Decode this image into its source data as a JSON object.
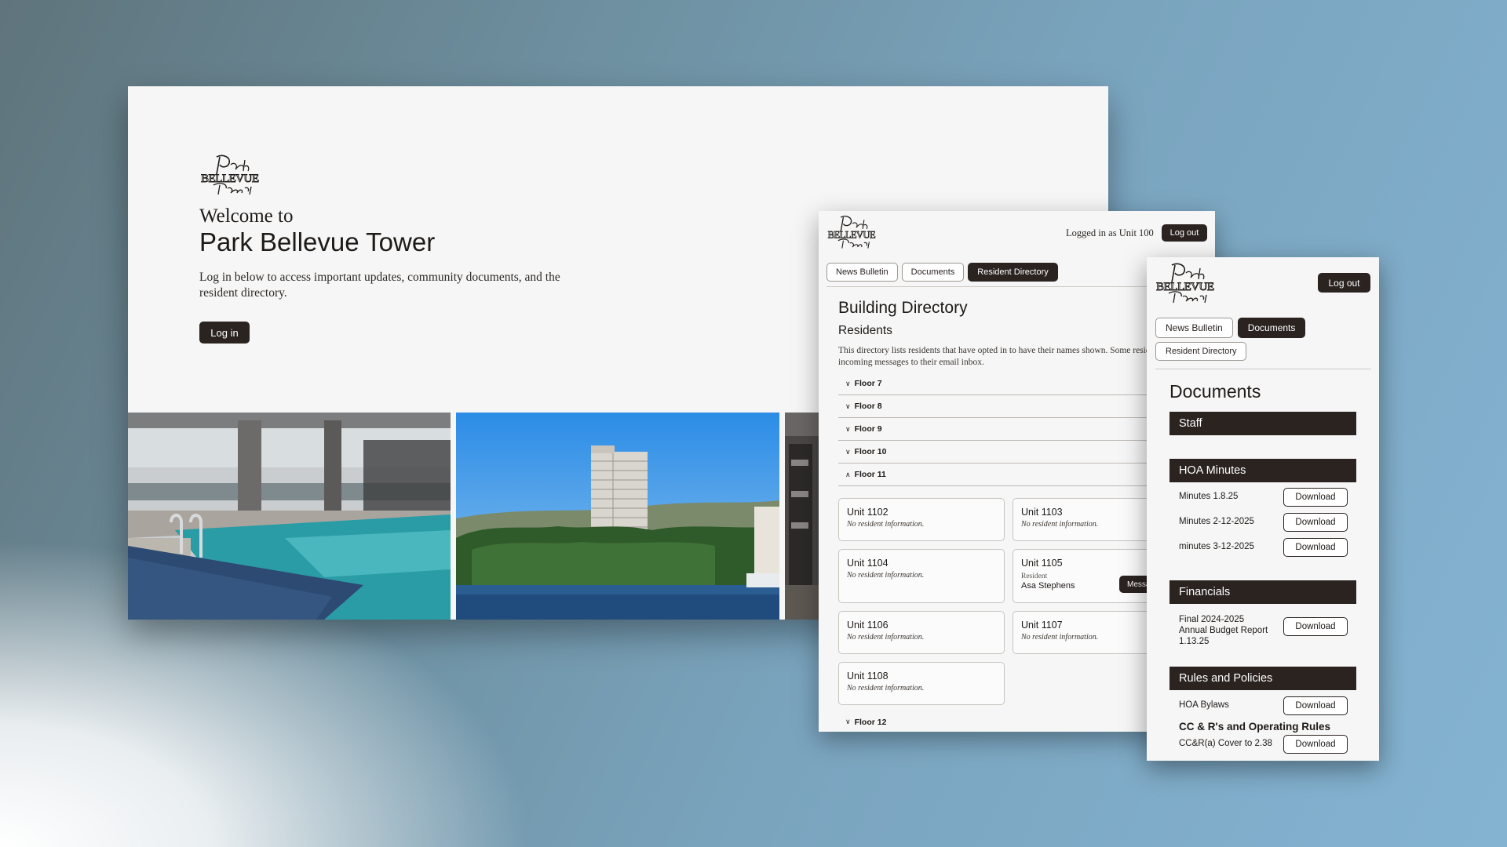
{
  "landing": {
    "welcome_pre": "Welcome to",
    "title": "Park Bellevue Tower",
    "description": "Log in below to access important updates, community documents, and the resident directory.",
    "login_label": "Log in"
  },
  "directory_window": {
    "logged_in_text": "Logged in as Unit 100",
    "logout_label": "Log out",
    "tabs": [
      {
        "label": "News Bulletin"
      },
      {
        "label": "Documents"
      },
      {
        "label": "Resident Directory"
      }
    ],
    "active_tab": "Resident Directory",
    "heading": "Building Directory",
    "subheading": "Residents",
    "description": "This directory lists residents that have opted in to have their names shown. Some residents have allowed incoming messages to their email inbox.",
    "floors_before": [
      {
        "label": "Floor 7",
        "expanded": false
      },
      {
        "label": "Floor 8",
        "expanded": false
      },
      {
        "label": "Floor 9",
        "expanded": false
      },
      {
        "label": "Floor 10",
        "expanded": false
      },
      {
        "label": "Floor 11",
        "expanded": true
      }
    ],
    "units": [
      {
        "name": "Unit 1102",
        "info": "No resident information."
      },
      {
        "name": "Unit 1103",
        "info": "No resident information."
      },
      {
        "name": "Unit 1104",
        "info": "No resident information."
      },
      {
        "name": "Unit 1105",
        "resident_label": "Resident",
        "resident_name": "Asa Stephens",
        "message_label": "Message"
      },
      {
        "name": "Unit 1106",
        "info": "No resident information."
      },
      {
        "name": "Unit 1107",
        "info": "No resident information."
      },
      {
        "name": "Unit 1108",
        "info": "No resident information."
      }
    ],
    "floors_after": [
      {
        "label": "Floor 12",
        "expanded": false
      }
    ]
  },
  "documents_window": {
    "logout_label": "Log out",
    "tabs": [
      {
        "label": "News Bulletin"
      },
      {
        "label": "Documents"
      },
      {
        "label": "Resident Directory"
      }
    ],
    "active_tab": "Documents",
    "heading": "Documents",
    "download_label": "Download",
    "sections": {
      "staff": {
        "title": "Staff"
      },
      "hoa_minutes": {
        "title": "HOA Minutes",
        "docs": [
          "Minutes 1.8.25",
          "Minutes 2-12-2025",
          "minutes 3-12-2025"
        ]
      },
      "financials": {
        "title": "Financials",
        "docs": [
          "Final 2024-2025 Annual Budget Report 1.13.25"
        ]
      },
      "rules": {
        "title": "Rules and Policies",
        "docs": [
          "HOA Bylaws"
        ],
        "subheading": "CC & R's and Operating Rules",
        "sub_docs": [
          "CC&R(a) Cover to 2.38"
        ]
      }
    }
  },
  "colors": {
    "accent_dark": "#2a2320",
    "page_bg": "#f6f6f6"
  }
}
